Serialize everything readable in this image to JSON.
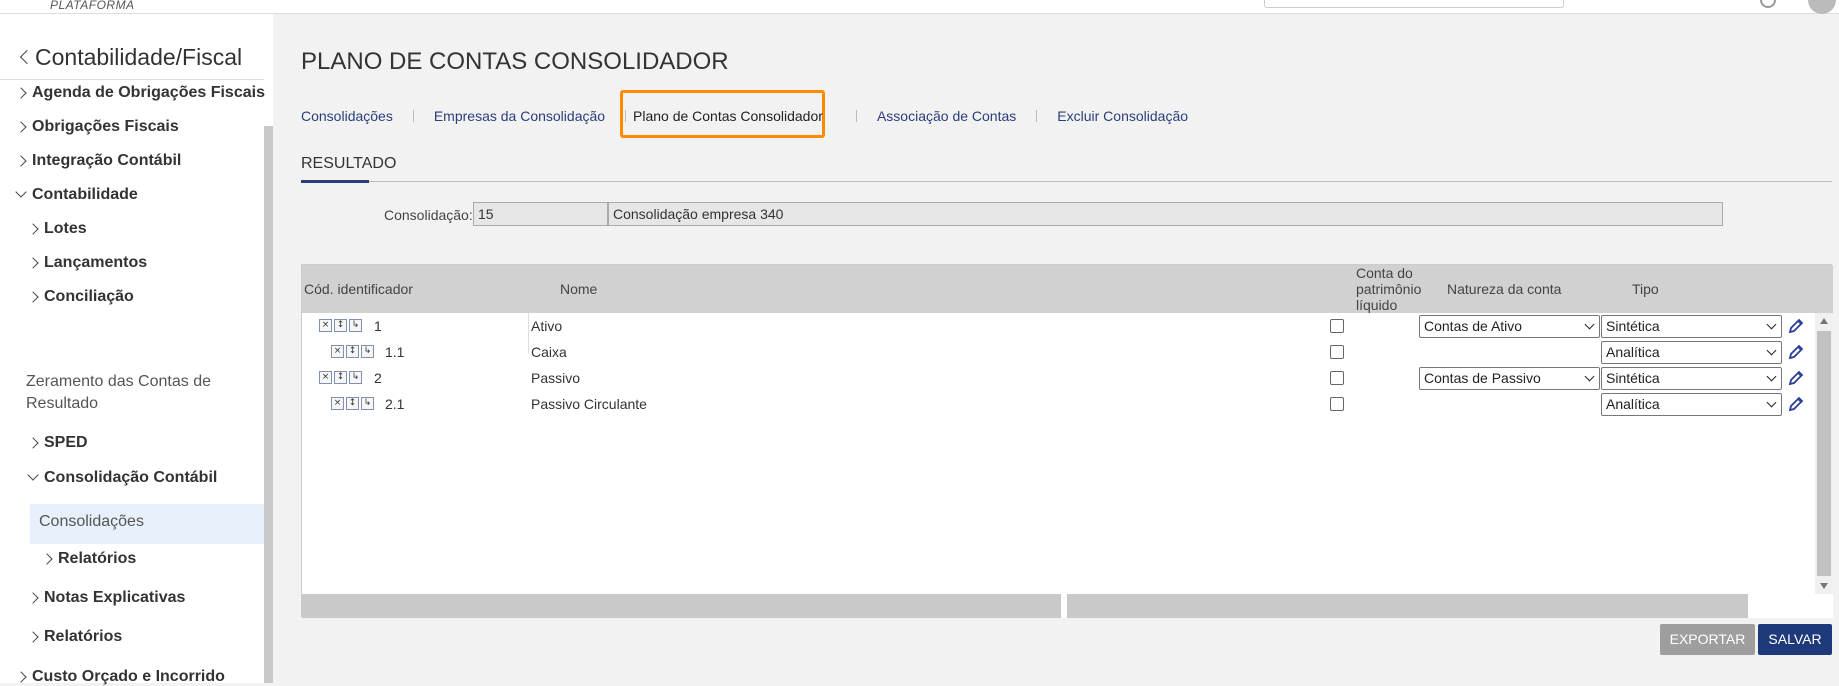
{
  "topbar": {
    "brand": "PLATAFORMA"
  },
  "sidebar": {
    "title": "Contabilidade/Fiscal",
    "items": [
      {
        "label": "Agenda de Obrigações Fiscais",
        "state": "collapsed"
      },
      {
        "label": "Obrigações Fiscais",
        "state": "collapsed"
      },
      {
        "label": "Integração Contábil",
        "state": "collapsed"
      },
      {
        "label": "Contabilidade",
        "state": "expanded"
      },
      {
        "label": "Lotes",
        "state": "collapsed"
      },
      {
        "label": "Lançamentos",
        "state": "collapsed"
      },
      {
        "label": "Conciliação",
        "state": "collapsed"
      },
      {
        "label": "Zeramento das Contas de Resultado",
        "state": "leaf"
      },
      {
        "label": "SPED",
        "state": "collapsed"
      },
      {
        "label": "Consolidação Contábil",
        "state": "expanded"
      },
      {
        "label": "Consolidações",
        "state": "active"
      },
      {
        "label": "Relatórios",
        "state": "collapsed"
      },
      {
        "label": "Notas Explicativas",
        "state": "collapsed"
      },
      {
        "label": "Relatórios",
        "state": "collapsed"
      },
      {
        "label": "Custo Orçado e Incorrido",
        "state": "collapsed"
      }
    ]
  },
  "page": {
    "title": "PLANO DE CONTAS CONSOLIDADOR",
    "tabs": [
      {
        "label": "Consolidações"
      },
      {
        "label": "Empresas da Consolidação"
      },
      {
        "label": "Plano de Contas Consolidador",
        "active": true
      },
      {
        "label": "Associação de Contas"
      },
      {
        "label": "Excluir Consolidação"
      }
    ],
    "section": "RESULTADO",
    "consolidacao": {
      "label": "Consolidação:",
      "code": "15",
      "name": "Consolidação empresa 340"
    }
  },
  "grid": {
    "headers": {
      "codigo": "Cód. identificador",
      "nome": "Nome",
      "patrimonio": "Conta do patrimônio líquido",
      "natureza": "Natureza da conta",
      "tipo": "Tipo"
    },
    "tool_icons": [
      "×",
      "↕",
      "↳"
    ],
    "rows": [
      {
        "code": "1",
        "level": 0,
        "name": "Ativo",
        "patrimonio": false,
        "natureza": "Contas de Ativo",
        "tipo": "Sintética"
      },
      {
        "code": "1.1",
        "level": 1,
        "name": "Caixa",
        "patrimonio": false,
        "natureza": "",
        "tipo": "Analítica"
      },
      {
        "code": "2",
        "level": 0,
        "name": "Passivo",
        "patrimonio": false,
        "natureza": "Contas de Passivo",
        "tipo": "Sintética"
      },
      {
        "code": "2.1",
        "level": 1,
        "name": "Passivo Circulante",
        "patrimonio": false,
        "natureza": "",
        "tipo": "Analítica"
      }
    ]
  },
  "actions": {
    "export": "EXPORTAR",
    "save": "SALVAR"
  },
  "colors": {
    "accent": "#1f3a7a",
    "highlight": "#ff8a00",
    "link": "#2a3e7a"
  }
}
